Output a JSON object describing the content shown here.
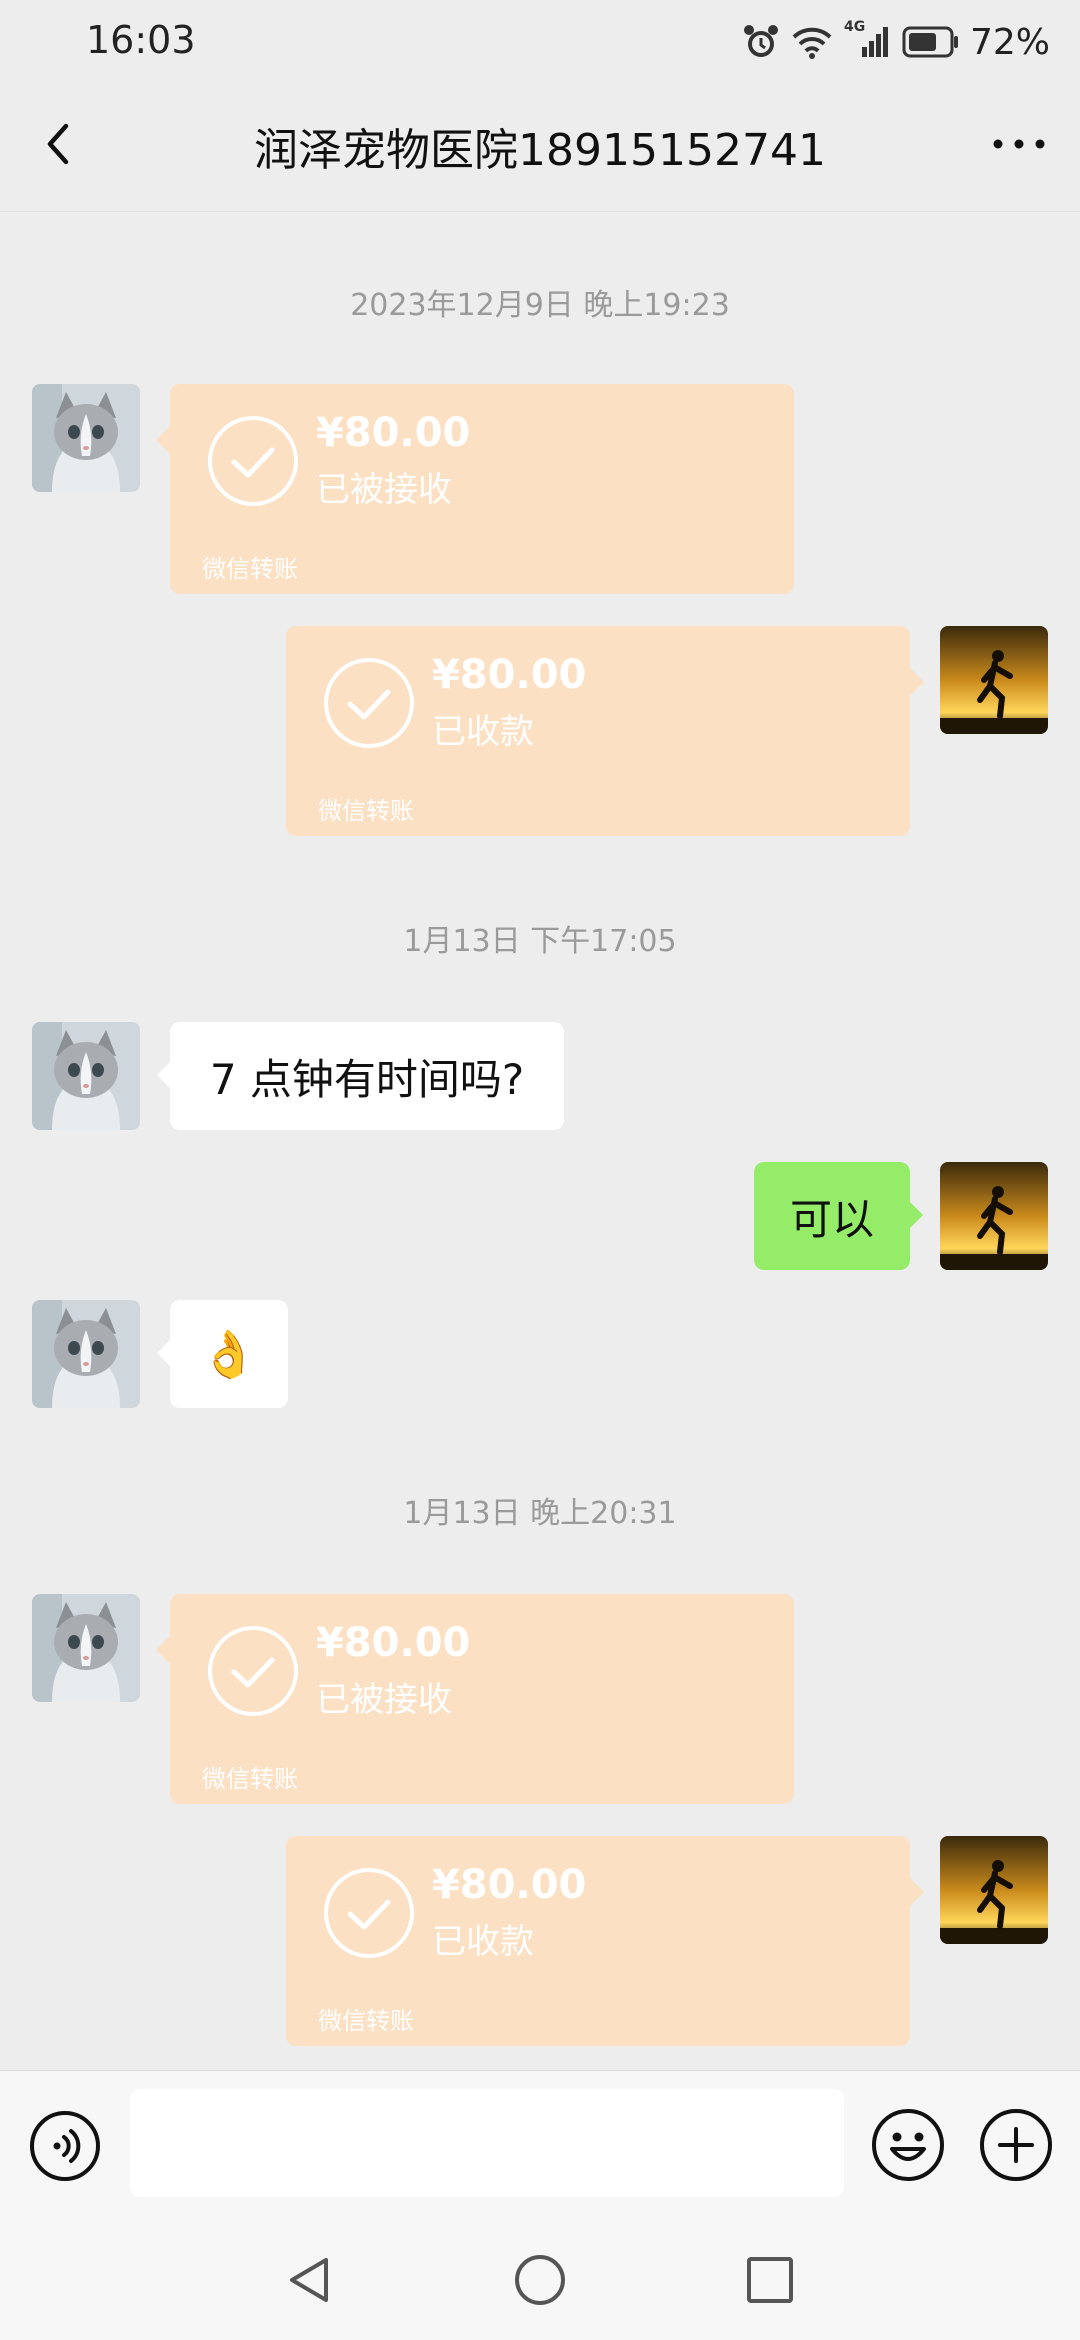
{
  "status_bar": {
    "time": "16:03",
    "battery_percent": "72%",
    "network_label": "4G"
  },
  "header": {
    "title": "润泽宠物医院18915152741"
  },
  "messages": {
    "ts1": "2023年12月9日 晚上19:23",
    "t1": {
      "amount": "¥80.00",
      "status": "已被接收",
      "footer": "微信转账"
    },
    "t2": {
      "amount": "¥80.00",
      "status": "已收款",
      "footer": "微信转账"
    },
    "ts2": "1月13日 下午17:05",
    "m1": "7 点钟有时间吗?",
    "m2": "可以",
    "m3": "👌",
    "ts3": "1月13日 晚上20:31",
    "t3": {
      "amount": "¥80.00",
      "status": "已被接收",
      "footer": "微信转账"
    },
    "t4": {
      "amount": "¥80.00",
      "status": "已收款",
      "footer": "微信转账"
    }
  },
  "input": {
    "value": "",
    "placeholder": ""
  },
  "colors": {
    "transfer_bg": "#fbe0c3",
    "sent_bubble": "#95ec69",
    "received_bubble": "#ffffff",
    "chat_bg": "#ededed"
  },
  "icons": {
    "back": "chevron-left-icon",
    "more": "more-dots-icon",
    "voice": "voice-icon",
    "emoji": "emoji-icon",
    "plus": "plus-icon",
    "check": "check-circle-icon"
  }
}
